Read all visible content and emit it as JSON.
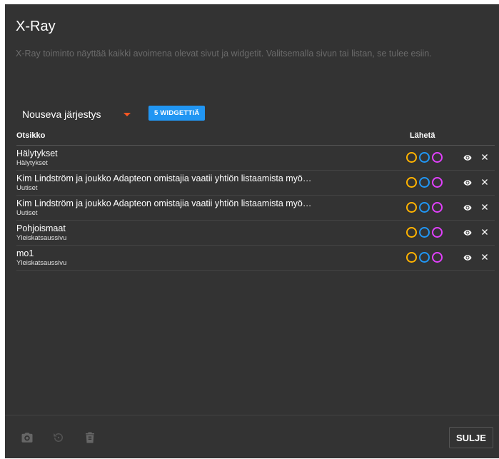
{
  "dialog": {
    "title": "X-Ray",
    "description": "X-Ray toiminto näyttää kaikki avoimena olevat sivut ja widgetit. Valitsemalla sivun tai listan, se tulee esiin."
  },
  "controls": {
    "sort_label": "Nouseva järjestys",
    "widget_count_label": "5 WIDGETTIÄ"
  },
  "table": {
    "headers": {
      "title": "Otsikko",
      "send": "Lähetä"
    },
    "rows": [
      {
        "title": "Hälytykset",
        "subtitle": "Hälytykset"
      },
      {
        "title": "Kim Lindström ja joukko Adapteon omistajia vaatii yhtiön listaamista myö…",
        "subtitle": "Uutiset"
      },
      {
        "title": "Kim Lindström ja joukko Adapteon omistajia vaatii yhtiön listaamista myö…",
        "subtitle": "Uutiset"
      },
      {
        "title": "Pohjoismaat",
        "subtitle": "Yleiskatsaussivu"
      },
      {
        "title": "mo1",
        "subtitle": "Yleiskatsaussivu"
      }
    ]
  },
  "send_colors": [
    "#ffb300",
    "#2196f3",
    "#e040fb"
  ],
  "row_icons": [
    "eye-icon",
    "close-icon"
  ],
  "footer": {
    "icons": [
      "camera-icon",
      "restore-icon",
      "delete-icon"
    ],
    "close_label": "SULJE"
  },
  "colors": {
    "background": "#333333",
    "accent_orange": "#ff5722",
    "badge_blue": "#2196f3"
  }
}
